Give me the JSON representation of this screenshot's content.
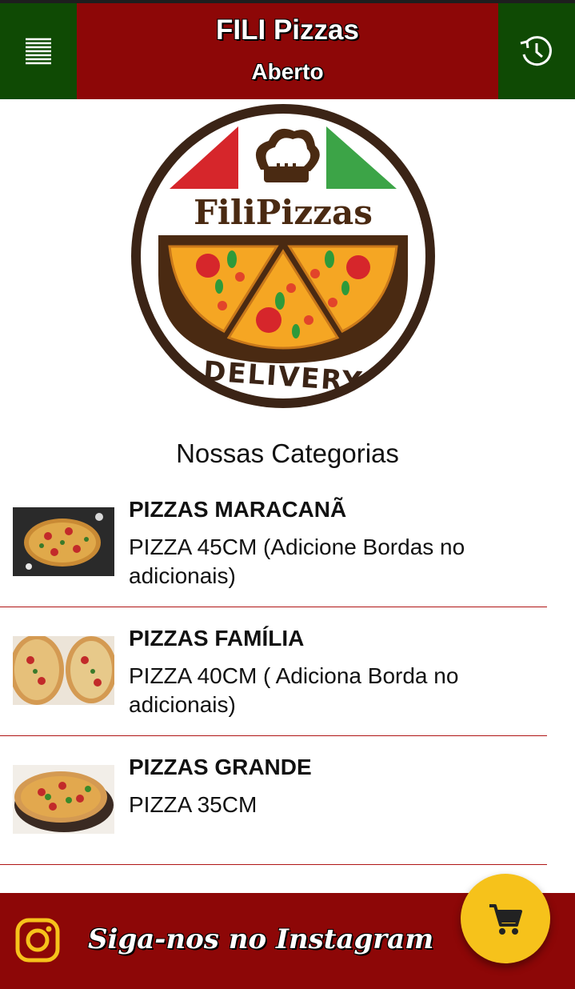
{
  "header": {
    "title": "FILI Pizzas",
    "status": "Aberto",
    "menu_icon": "menu-icon",
    "history_icon": "history-icon",
    "side_color": "#0f4a04",
    "center_color": "#8d0707"
  },
  "logo": {
    "wordmark": "FiliPizzas",
    "tagline": "DELIVERY"
  },
  "section_title": "Nossas Categorias",
  "categories": [
    {
      "name": "PIZZAS MARACANÃ",
      "description": "PIZZA 45CM (Adicione Bordas no adicionais)"
    },
    {
      "name": "PIZZAS FAMÍLIA",
      "description": "PIZZA 40CM ( Adiciona Borda no adicionais)"
    },
    {
      "name": "PIZZAS GRANDE",
      "description": "PIZZA 35CM"
    }
  ],
  "footer": {
    "instagram_label": "Siga-nos no Instagram",
    "instagram_icon": "instagram-icon",
    "background_color": "#8d0707"
  },
  "cart": {
    "icon": "cart-icon",
    "color": "#f6c21b"
  }
}
